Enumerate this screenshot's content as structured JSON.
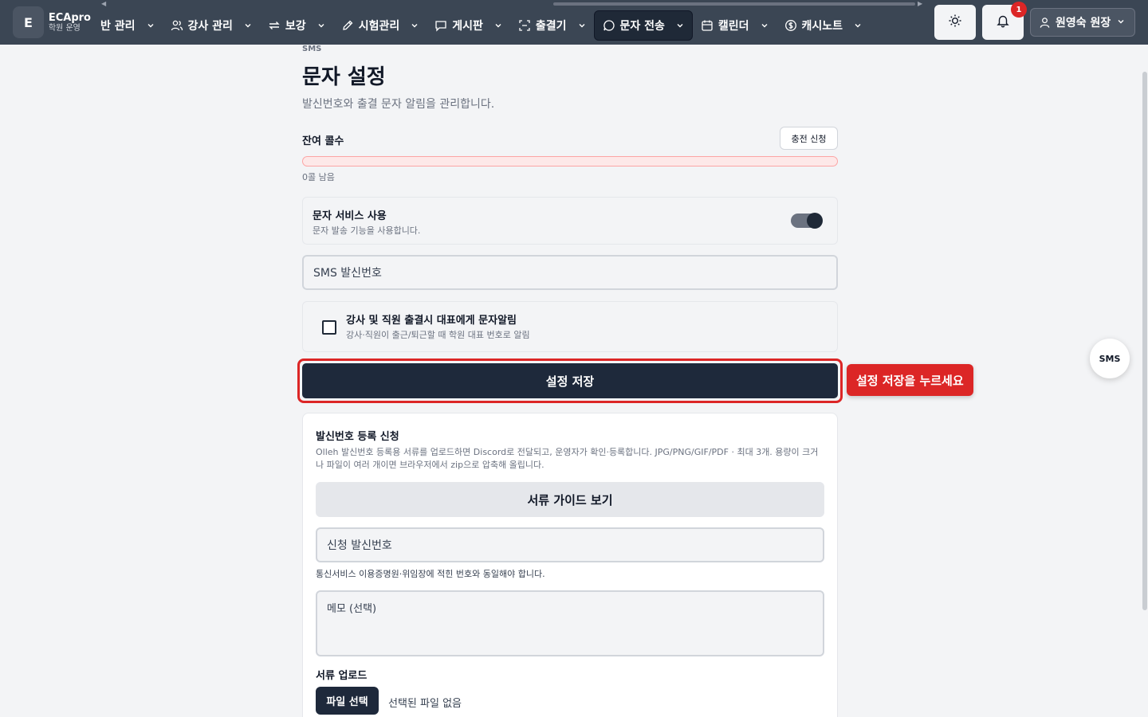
{
  "brand": {
    "logo_letter": "E",
    "name": "ECApro",
    "sub": "학원 운영"
  },
  "nav": {
    "items": [
      {
        "label": "반 관리",
        "icon": "class-icon"
      },
      {
        "label": "강사 관리",
        "icon": "users-icon"
      },
      {
        "label": "보강",
        "icon": "repeat-icon"
      },
      {
        "label": "시험관리",
        "icon": "pen-icon"
      },
      {
        "label": "게시판",
        "icon": "message-square-icon"
      },
      {
        "label": "출결기",
        "icon": "scan-icon"
      },
      {
        "label": "문자 전송",
        "icon": "message-circle-icon",
        "active": true
      },
      {
        "label": "캘린더",
        "icon": "calendar-icon"
      },
      {
        "label": "캐시노트",
        "icon": "dollar-icon"
      }
    ]
  },
  "header": {
    "notification_count": "1",
    "user_label": "원영숙 원장"
  },
  "page": {
    "crumb": "SMS",
    "title": "문자 설정",
    "description": "발신번호와 출결 문자 알림을 관리합니다."
  },
  "balance": {
    "label": "잔여 콜수",
    "charge_button": "충전 신청",
    "progress_fraction": 0.0,
    "remaining_text": "0콜 남음"
  },
  "service": {
    "title": "문자 서비스 사용",
    "subtitle": "문자 발송 기능을 사용합니다.",
    "enabled": true
  },
  "sms_sender": {
    "placeholder": "SMS 발신번호"
  },
  "notify": {
    "title": "강사 및 직원 출결시 대표에게 문자알림",
    "subtitle": "강사·직원이 출근/퇴근할 때 학원 대표 번호로 알림",
    "checked": false
  },
  "save": {
    "label": "설정 저장",
    "tooltip": "설정 저장을 누르세요"
  },
  "registration": {
    "title": "발신번호 등록 신청",
    "description": "Olleh 발신번호 등록용 서류를 업로드하면 Discord로 전달되고, 운영자가 확인·등록합니다. JPG/PNG/GIF/PDF · 최대 3개. 용량이 크거나 파일이 여러 개이면 브라우저에서 zip으로 압축해 올립니다.",
    "guide_button": "서류 가이드 보기",
    "number_placeholder": "신청 발신번호",
    "number_hint": "통신서비스 이용증명원·위임장에 적힌 번호와 동일해야 합니다.",
    "memo_placeholder": "메모 (선택)",
    "upload_label": "서류 업로드",
    "file_button": "파일 선택",
    "file_status": "선택된 파일 없음"
  },
  "fab": {
    "label": "SMS"
  },
  "colors": {
    "topbar": "#3b4654",
    "primary": "#1e293b",
    "danger": "#dc2626"
  }
}
